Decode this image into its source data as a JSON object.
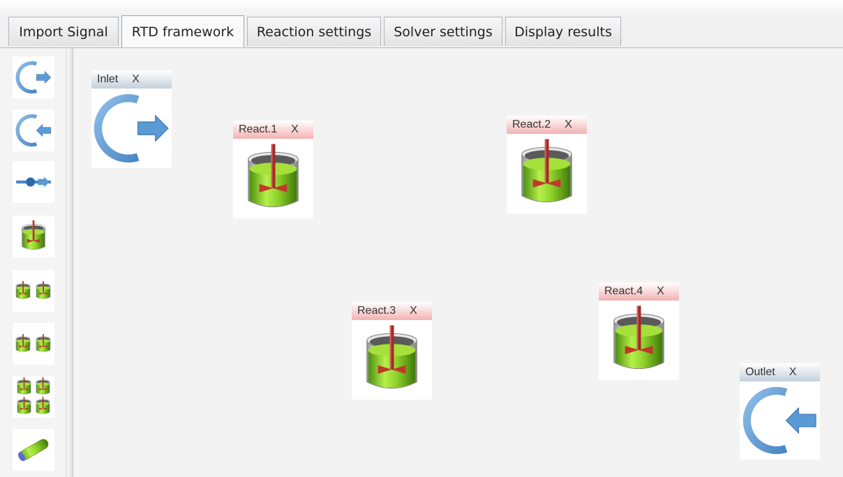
{
  "tabs": [
    {
      "label": "Import Signal"
    },
    {
      "label": "RTD framework"
    },
    {
      "label": "Reaction settings"
    },
    {
      "label": "Solver settings"
    },
    {
      "label": "Display results"
    }
  ],
  "active_tab": "RTD framework",
  "palette": [
    {
      "icon": "inlet-icon"
    },
    {
      "icon": "outlet-icon"
    },
    {
      "icon": "pipe-connector-icon"
    },
    {
      "icon": "reactor-icon"
    },
    {
      "icon": "two-reactors-series-icon"
    },
    {
      "icon": "two-reactors-parallel-icon"
    },
    {
      "icon": "four-reactors-icon"
    },
    {
      "icon": "plug-flow-tube-icon"
    }
  ],
  "nodes": {
    "inlet": {
      "label": "Inlet",
      "close": "X"
    },
    "react1": {
      "label": "React.1",
      "close": "X"
    },
    "react2": {
      "label": "React.2",
      "close": "X"
    },
    "react3": {
      "label": "React.3",
      "close": "X"
    },
    "react4": {
      "label": "React.4",
      "close": "X"
    },
    "outlet": {
      "label": "Outlet",
      "close": "X"
    }
  },
  "colors": {
    "port_blue": "#5b9bd5",
    "reactor_green": "#8ed02a",
    "reactor_red": "#c0392b",
    "header_red": "#f3b1b1",
    "header_blue": "#c4d0dc"
  }
}
